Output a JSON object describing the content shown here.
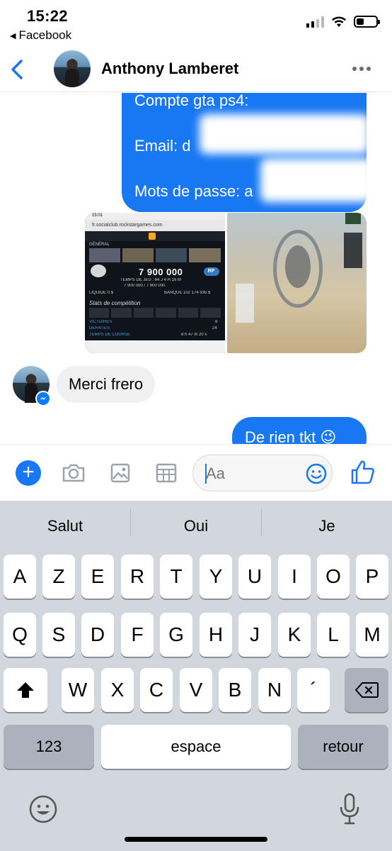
{
  "status_bar": {
    "time": "15:22",
    "back_app": "Facebook",
    "battery_level": 0.4
  },
  "header": {
    "contact_name": "Anthony Lamberet"
  },
  "messages": {
    "outgoing_1": {
      "line1": "Compte gta ps4:",
      "line2": "Email: d",
      "line3": "Mots de passe: a"
    },
    "shared_images": {
      "left": {
        "status_time": "15:01",
        "url": "fr.socialclub.rockstargames.com",
        "section": "GÉNÉRAL",
        "money": "7 900 000",
        "rp_badge": "RP",
        "play_time": "TEMPS DE JEU : 64 J 4 H 16 M",
        "xp": "7 900 000 / 7 900 000",
        "cash": "LIQUIDE 0 $",
        "bank": "BANQUE 102 174 935 $",
        "stats_title": "Stats de compétition",
        "victories_label": "VICTOIRES",
        "victories_value": "8",
        "defeats_label": "DÉFAITES",
        "defeats_value": "24",
        "race_time_label": "TEMPS DE COURSE",
        "race_time_value": "8 h 47 m 20 s"
      }
    },
    "incoming_1": "Merci frero",
    "outgoing_2": "De rien tkt 😉"
  },
  "composer": {
    "placeholder": "Aa"
  },
  "keyboard": {
    "suggestions": [
      "Salut",
      "Oui",
      "Je"
    ],
    "row1": [
      "A",
      "Z",
      "E",
      "R",
      "T",
      "Y",
      "U",
      "I",
      "O",
      "P"
    ],
    "row2": [
      "Q",
      "S",
      "D",
      "F",
      "G",
      "H",
      "J",
      "K",
      "L",
      "M"
    ],
    "row3": [
      "W",
      "X",
      "C",
      "V",
      "B",
      "N",
      "´"
    ],
    "numbers_key": "123",
    "space_key": "espace",
    "return_key": "retour"
  },
  "colors": {
    "messenger_blue": "#1877f2",
    "incoming_bubble": "#f0f0f0",
    "keyboard_bg": "#d2d6dd"
  }
}
